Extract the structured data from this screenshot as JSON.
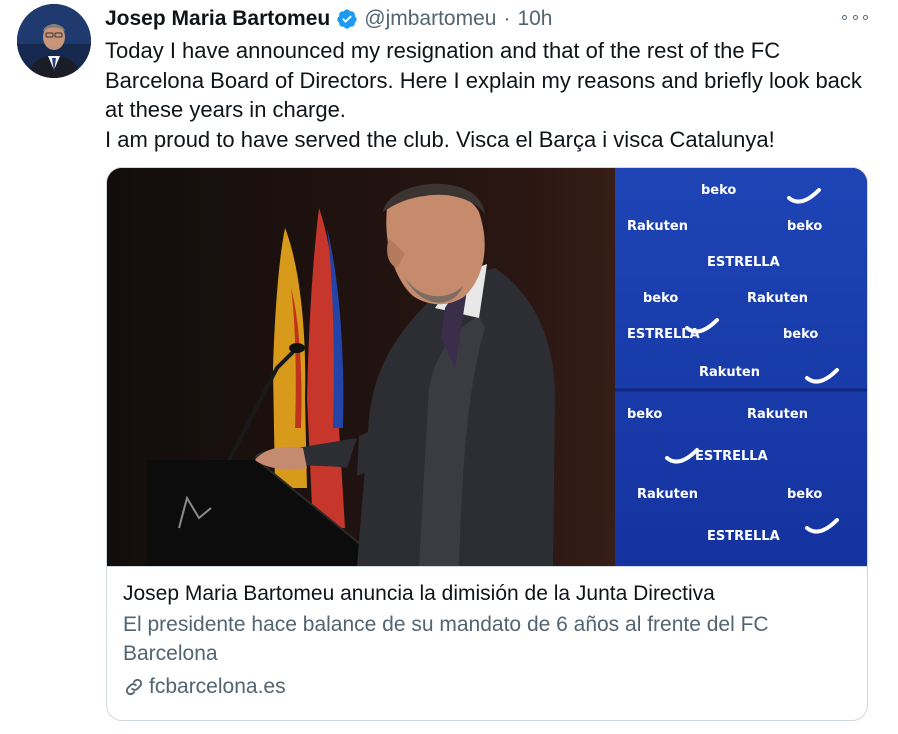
{
  "author": {
    "display_name": "Josep Maria Bartomeu",
    "handle": "@jmbartomeu",
    "separator": "·",
    "time": "10h",
    "verified": true,
    "avatar_icon": "user-avatar-photo"
  },
  "tweet": {
    "lines": [
      "Today I have announced my resignation and that of the rest of the FC Barcelona Board of Directors. Here I explain my reasons and briefly look back at these years in charge.",
      "I am proud to have served the club. Visca el Barça i visca Catalunya!"
    ]
  },
  "card": {
    "title": "Josep Maria Bartomeu anuncia la dimisión de la Junta Directiva",
    "description": "El presidente hace balance de su mandato de 6 años al frente del FC Barcelona",
    "domain": "fcbarcelona.es",
    "image_icon": "press-conference-photo",
    "sponsor_wall": [
      "beko",
      "Rakuten",
      "ESTRELLA"
    ]
  },
  "colors": {
    "text": "#0f1419",
    "secondary": "#536471",
    "verified": "#1d9bf0",
    "border": "#cfd9de",
    "sponsor_wall": "#1a3fa8"
  }
}
